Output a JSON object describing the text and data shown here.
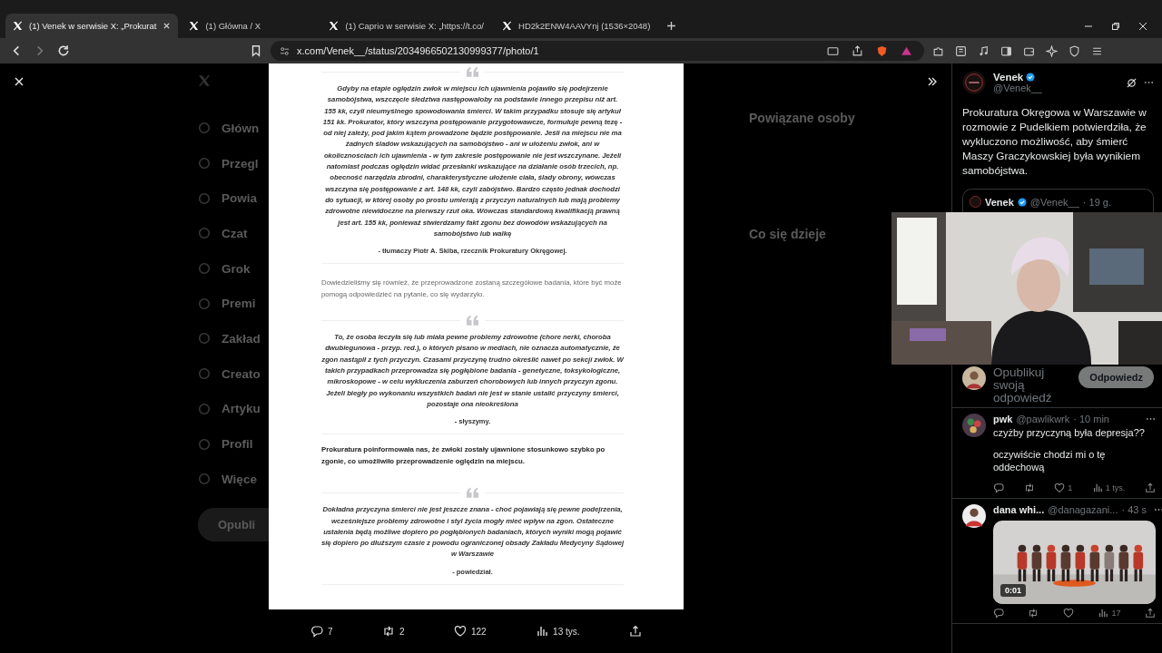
{
  "browser": {
    "tabs": [
      {
        "title": "(1) Venek w serwisie X: „Prokurat",
        "selected": true
      },
      {
        "title": "(1) Główna / X",
        "selected": false
      },
      {
        "title": "(1) Caprio w serwisie X: „https://t.co/",
        "selected": false
      },
      {
        "title": "HD2k2ENW4AAVYnj (1536×2048)",
        "selected": false
      }
    ],
    "url": "x.com/Venek__/status/2034966502130999377/photo/1"
  },
  "background_page": {
    "nav": [
      "Główn",
      "Przegl",
      "Powia",
      "Czat",
      "Grok",
      "Premi",
      "Zakład",
      "Creato",
      "Artyku",
      "Profil",
      "Więce"
    ],
    "post_button": "Opubli",
    "headings": [
      "Powiązane osoby",
      "Co się dzieje"
    ]
  },
  "photo": {
    "blocks": [
      {
        "kind": "quote",
        "text": "Gdyby na etapie oględzin zwłok w miejscu ich ujawnienia pojawiło się podejrzenie samobójstwa, wszczęcie śledztwa następowałoby na podstawie innego przepisu niż art. 155 kk, czyli nieumyślnego spowodowania śmierci. W takim przypadku stosuje się artykuł 151 kk. Prokurator, który wszczyna postępowanie przygotowawcze, formułuje pewną tezę - od niej zależy, pod jakim kątem prowadzone będzie postępowanie. Jeśli na miejscu nie ma żadnych śladów wskazujących na samobójstwo - ani w ułożeniu zwłok, ani w okolicznościach ich ujawnienia - w tym zakresie postępowanie nie jest wszczynane. Jeżeli natomiast podczas oględzin widać przesłanki wskazujące na działanie osób trzecich, np. obecność narzędzia zbrodni, charakterystyczne ułożenie ciała, ślady obrony, wówczas wszczyna się postępowanie z art. 148 kk, czyli zabójstwo. Bardzo często jednak dochodzi do sytuacji, w której osoby po prostu umierają z przyczyn naturalnych lub mają problemy zdrowotne niewidoczne na pierwszy rzut oka. Wówczas standardową kwalifikacją prawną jest art. 155 kk, ponieważ stwierdzamy fakt zgonu bez dowodów wskazujących na samobójstwo lub walkę",
        "attribution": "- tłumaczy Piotr A. Skiba, rzecznik Prokuratury Okręgowej."
      },
      {
        "kind": "paragraph",
        "bold": false,
        "text": "Dowiedzieliśmy się również, że przeprowadzone zostaną szczegółowe badania, które być może pomogą odpowiedzieć na pytanie, co się wydarzyło."
      },
      {
        "kind": "quote",
        "text": "To, że osoba leczyła się lub miała pewne problemy zdrowotne (chore nerki, choroba dwubiegunowa - przyp. red.), o których pisano w mediach, nie oznacza automatycznie, że zgon nastąpił z tych przyczyn. Czasami przyczynę trudno określić nawet po sekcji zwłok. W takich przypadkach przeprowadza się pogłębione badania - genetyczne, toksykologiczne, mikroskopowe - w celu wykluczenia zaburzeń chorobowych lub innych przyczyn zgonu. Jeżeli biegły po wykonaniu wszystkich badań nie jest w stanie ustalić przyczyny śmierci, pozostaje ona nieokreślona",
        "attribution": "- słyszymy."
      },
      {
        "kind": "paragraph",
        "bold": true,
        "text": "Prokuratura poinformowała nas, że zwłoki zostały ujawnione stosunkowo szybko po zgonie, co umożliwiło przeprowadzenie oględzin na miejscu."
      },
      {
        "kind": "quote",
        "text": "Dokładna przyczyna śmierci nie jest jeszcze znana - choć pojawiają się pewne podejrzenia, wcześniejsze problemy zdrowotne i styl życia mogły mieć wpływ na zgon. Ostateczne ustalenia będą możliwe dopiero po pogłębionych badaniach, których wyniki mogą pojawić się dopiero po dłuższym czasie z powodu ograniczonej obsady Zakładu Medycyny Sądowej w Warszawie",
        "attribution": "- powiedział."
      }
    ]
  },
  "photo_actions": [
    {
      "kind": "reply",
      "count": "7"
    },
    {
      "kind": "repost",
      "count": "2"
    },
    {
      "kind": "like",
      "count": "122"
    },
    {
      "kind": "views",
      "count": "13 tys."
    },
    {
      "kind": "share"
    }
  ],
  "post": {
    "name": "Venek",
    "handle": "@Venek__",
    "text": "Prokuratura Okręgowa w Warszawie w rozmowie z Pudelkiem potwierdziła, że wykluczono możliwość, aby śmierć Maszy Graczykowskiej była wynikiem samobójstwa.",
    "quote": {
      "name": "Venek",
      "handle": "@Venek__",
      "time": "· 19 g."
    }
  },
  "reply_box": {
    "placeholder": "Opublikuj swoją odpowiedź",
    "button": "Odpowiedz"
  },
  "replies": [
    {
      "name": "pwk",
      "handle": "@pawlikwrk",
      "time": "· 10 min",
      "paragraphs": [
        "czyżby przyczyną była depresja??",
        "oczywiście chodzi mi o tę oddechową"
      ],
      "stats": [
        {
          "kind": "reply"
        },
        {
          "kind": "repost"
        },
        {
          "kind": "like",
          "count": "1"
        },
        {
          "kind": "views",
          "count": "1 tys."
        },
        {
          "kind": "share"
        }
      ]
    },
    {
      "name": "dana whi...",
      "handle": "@danagazani...",
      "time": "· 43 s",
      "media": {
        "kind": "picture",
        "duration": "0:01"
      },
      "stats": [
        {
          "kind": "reply"
        },
        {
          "kind": "repost"
        },
        {
          "kind": "like"
        },
        {
          "kind": "views",
          "count": "17"
        },
        {
          "kind": "share"
        }
      ]
    }
  ]
}
